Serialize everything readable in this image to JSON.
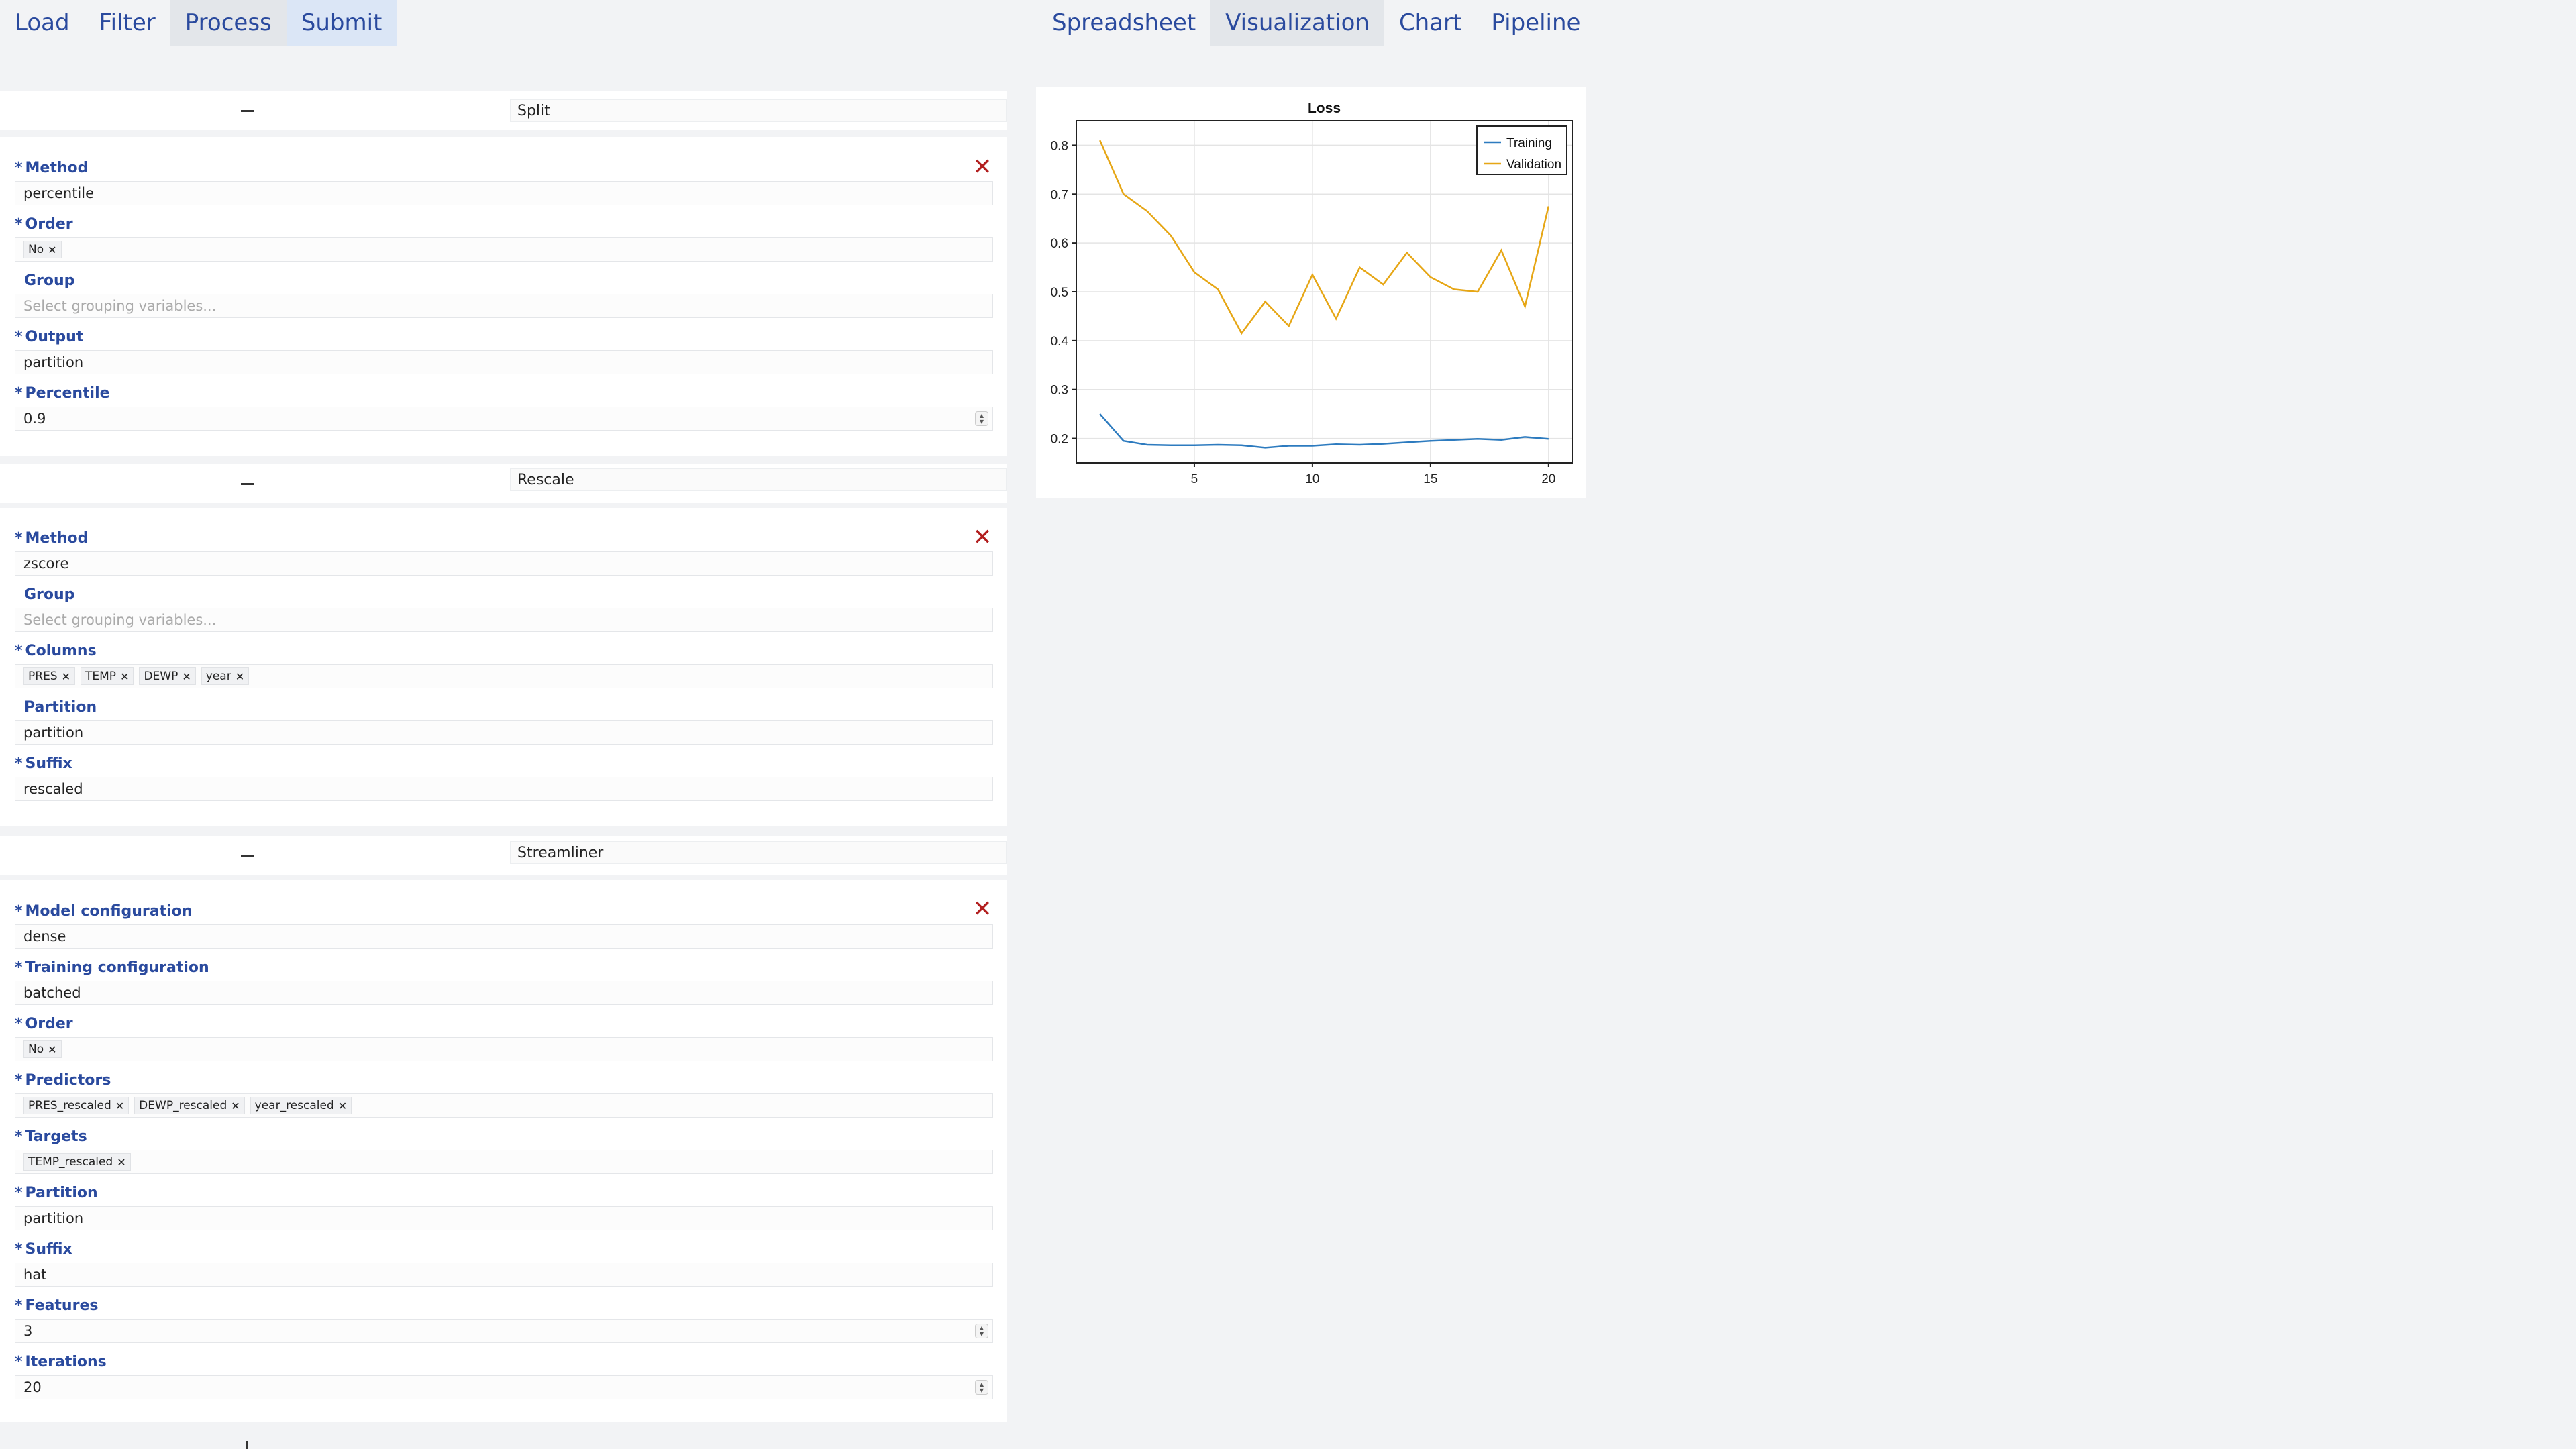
{
  "nav_left": [
    "Load",
    "Filter",
    "Process",
    "Submit"
  ],
  "nav_right": [
    "Spreadsheet",
    "Visualization",
    "Chart",
    "Pipeline"
  ],
  "steps": {
    "split": {
      "name": "Split",
      "method_label": "Method",
      "method_value": "percentile",
      "order_label": "Order",
      "order_tags": [
        "No"
      ],
      "group_label": "Group",
      "group_placeholder": "Select grouping variables...",
      "output_label": "Output",
      "output_value": "partition",
      "percentile_label": "Percentile",
      "percentile_value": "0.9"
    },
    "rescale": {
      "name": "Rescale",
      "method_label": "Method",
      "method_value": "zscore",
      "group_label": "Group",
      "group_placeholder": "Select grouping variables...",
      "columns_label": "Columns",
      "columns_tags": [
        "PRES",
        "TEMP",
        "DEWP",
        "year"
      ],
      "partition_label": "Partition",
      "partition_value": "partition",
      "suffix_label": "Suffix",
      "suffix_value": "rescaled"
    },
    "streamliner": {
      "name": "Streamliner",
      "model_label": "Model configuration",
      "model_value": "dense",
      "training_label": "Training configuration",
      "training_value": "batched",
      "order_label": "Order",
      "order_tags": [
        "No"
      ],
      "predictors_label": "Predictors",
      "predictors_tags": [
        "PRES_rescaled",
        "DEWP_rescaled",
        "year_rescaled"
      ],
      "targets_label": "Targets",
      "targets_tags": [
        "TEMP_rescaled"
      ],
      "partition_label": "Partition",
      "partition_value": "partition",
      "suffix_label": "Suffix",
      "suffix_value": "hat",
      "features_label": "Features",
      "features_value": "3",
      "iterations_label": "Iterations",
      "iterations_value": "20"
    }
  },
  "icons": {
    "collapse": "minus-icon",
    "remove": "close-icon",
    "stepper": "stepper-icon",
    "tag_remove": "x-icon"
  },
  "colors": {
    "nav_text": "#2a4a9e",
    "label_text": "#2a4a9e",
    "remove": "#b21e1e",
    "training": "#2d7bbf",
    "validation": "#e6a615"
  },
  "chart_data": {
    "type": "line",
    "title": "Loss",
    "xlabel": "",
    "ylabel": "",
    "x": [
      1,
      2,
      3,
      4,
      5,
      6,
      7,
      8,
      9,
      10,
      11,
      12,
      13,
      14,
      15,
      16,
      17,
      18,
      19,
      20
    ],
    "xlim": [
      0,
      21
    ],
    "ylim": [
      0.15,
      0.85
    ],
    "xticks": [
      5,
      10,
      15,
      20
    ],
    "yticks": [
      0.2,
      0.3,
      0.4,
      0.5,
      0.6,
      0.7,
      0.8
    ],
    "grid": true,
    "legend_position": "top-right",
    "series": [
      {
        "name": "Training",
        "color": "#2d7bbf",
        "values": [
          0.25,
          0.195,
          0.187,
          0.186,
          0.186,
          0.187,
          0.186,
          0.181,
          0.185,
          0.185,
          0.188,
          0.187,
          0.189,
          0.192,
          0.195,
          0.197,
          0.199,
          0.197,
          0.203,
          0.199
        ]
      },
      {
        "name": "Validation",
        "color": "#e6a615",
        "values": [
          0.81,
          0.7,
          0.665,
          0.615,
          0.54,
          0.505,
          0.415,
          0.48,
          0.43,
          0.535,
          0.445,
          0.55,
          0.515,
          0.58,
          0.53,
          0.505,
          0.5,
          0.585,
          0.47,
          0.675
        ]
      }
    ]
  }
}
